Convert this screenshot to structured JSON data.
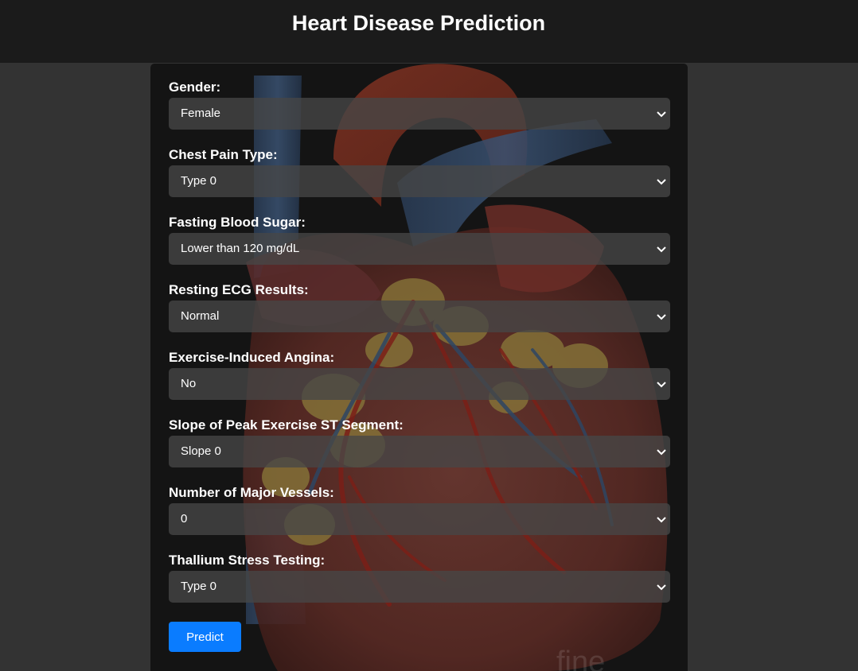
{
  "header": {
    "title": "Heart Disease Prediction"
  },
  "form": {
    "fields": [
      {
        "label": "Gender:",
        "value": "Female"
      },
      {
        "label": "Chest Pain Type:",
        "value": "Type 0"
      },
      {
        "label": "Fasting Blood Sugar:",
        "value": "Lower than 120 mg/dL"
      },
      {
        "label": "Resting ECG Results:",
        "value": "Normal"
      },
      {
        "label": "Exercise-Induced Angina:",
        "value": "No"
      },
      {
        "label": "Slope of Peak Exercise ST Segment:",
        "value": "Slope 0"
      },
      {
        "label": "Number of Major Vessels:",
        "value": "0"
      },
      {
        "label": "Thallium Stress Testing:",
        "value": "Type 0"
      }
    ],
    "predict_label": "Predict"
  },
  "background": {
    "image": "heart-illustration",
    "watermark": "fine"
  },
  "colors": {
    "page_bg": "#333333",
    "header_bg": "#1b1b1b",
    "card_bg": "#141414",
    "accent": "#0a7cff",
    "text": "#ffffff"
  }
}
